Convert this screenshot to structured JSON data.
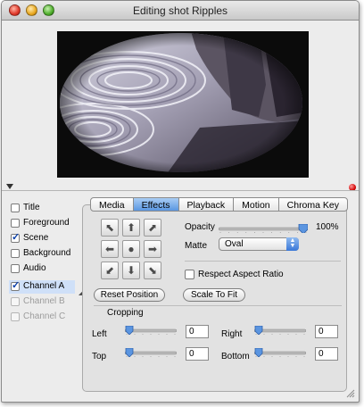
{
  "window": {
    "title": "Editing shot Ripples"
  },
  "tracks": [
    {
      "label": "Title",
      "checked": false,
      "enabled": true
    },
    {
      "label": "Foreground",
      "checked": false,
      "enabled": true
    },
    {
      "label": "Scene",
      "checked": true,
      "enabled": true
    },
    {
      "label": "Background",
      "checked": false,
      "enabled": true
    },
    {
      "label": "Audio",
      "checked": false,
      "enabled": true
    },
    {
      "label": "Channel A",
      "checked": true,
      "enabled": true,
      "selected": true
    },
    {
      "label": "Channel B",
      "checked": false,
      "enabled": false
    },
    {
      "label": "Channel C",
      "checked": false,
      "enabled": false
    }
  ],
  "tabs": [
    {
      "label": "Media",
      "active": false
    },
    {
      "label": "Effects",
      "active": true
    },
    {
      "label": "Playback",
      "active": false
    },
    {
      "label": "Motion",
      "active": false
    },
    {
      "label": "Chroma Key",
      "active": false
    }
  ],
  "effects": {
    "opacity_label": "Opacity",
    "opacity_value": "100%",
    "opacity_fraction": 1.0,
    "matte_label": "Matte",
    "matte_value": "Oval",
    "aspect_label": "Respect Aspect Ratio",
    "aspect_checked": false,
    "reset_button": "Reset Position",
    "scale_button": "Scale To Fit",
    "cropping_label": "Cropping",
    "crop": {
      "left_label": "Left",
      "left_value": "0",
      "right_label": "Right",
      "right_value": "0",
      "top_label": "Top",
      "top_value": "0",
      "bottom_label": "Bottom",
      "bottom_value": "0"
    },
    "position_pad_icons": [
      "arrow-up-left-icon",
      "arrow-up-icon",
      "arrow-up-right-icon",
      "arrow-left-icon",
      "center-dot-icon",
      "arrow-right-icon",
      "arrow-down-left-icon",
      "arrow-down-icon",
      "arrow-down-right-icon"
    ]
  },
  "colors": {
    "selection": "#cfe0f8",
    "active_tab": "#5a96e1",
    "record_dot": "#d00000"
  }
}
